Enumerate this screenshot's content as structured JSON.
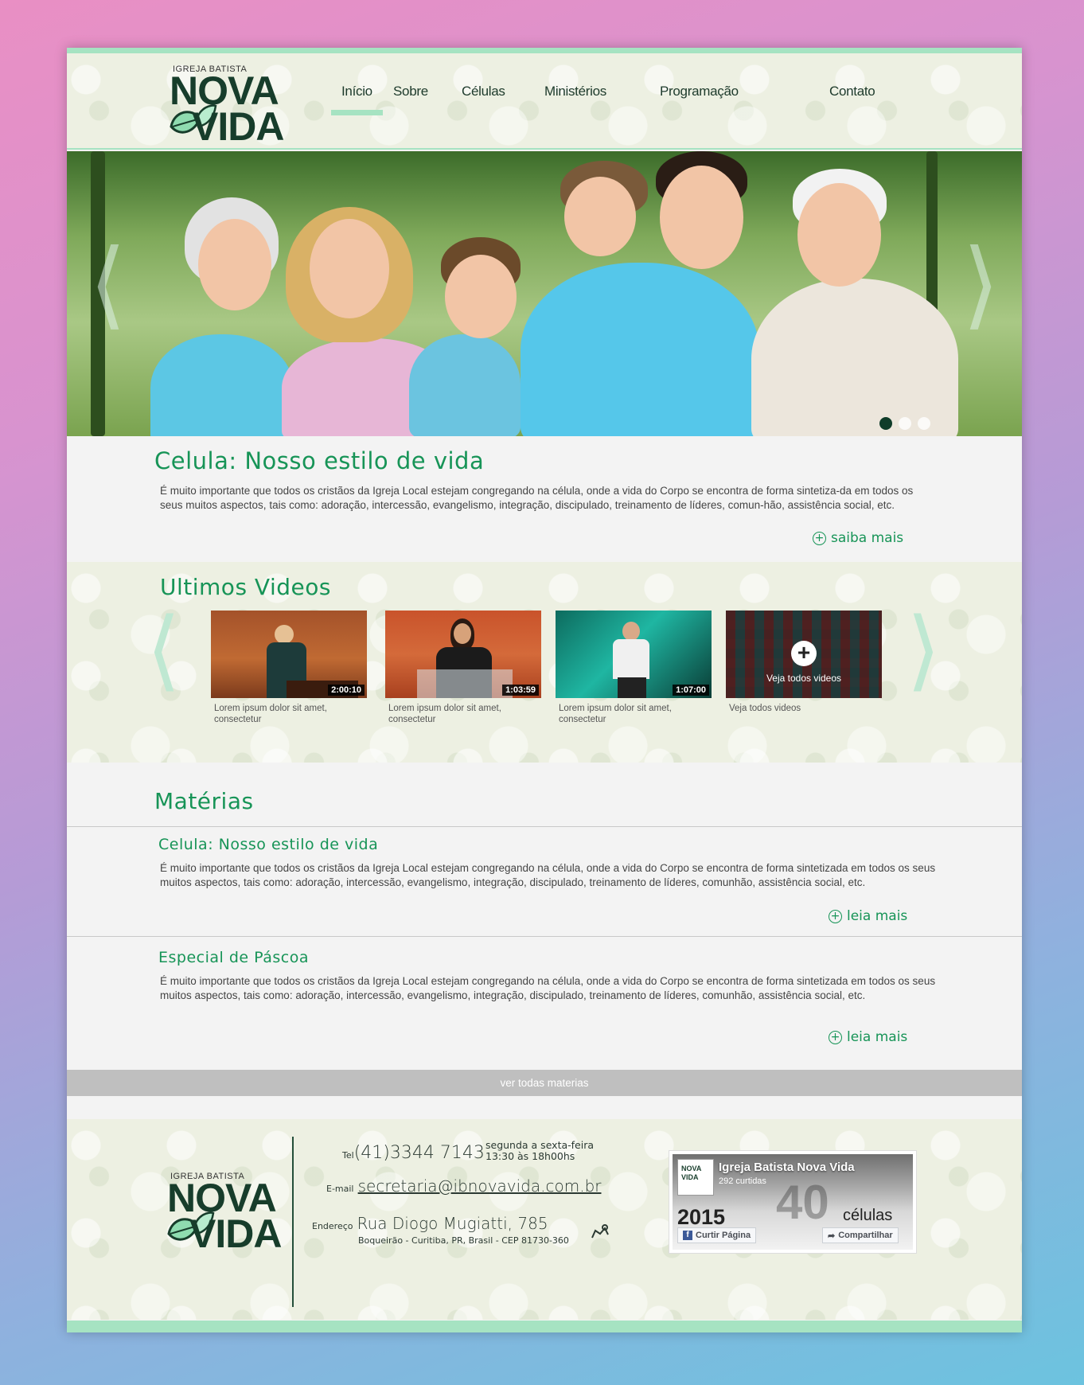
{
  "logo": {
    "pre": "IGREJA BATISTA",
    "line1": "NOVA",
    "line2": "VIDA"
  },
  "nav": [
    {
      "label": "Início"
    },
    {
      "label": "Sobre"
    },
    {
      "label": "Células"
    },
    {
      "label": "Ministérios"
    },
    {
      "label": "Programação"
    },
    {
      "label": "Contato"
    }
  ],
  "hero": {
    "prev": "⟨",
    "next": "⟩",
    "slide_count": 3,
    "active_slide": 1
  },
  "intro": {
    "title": "Celula: Nosso estilo de vida",
    "text": "É muito importante que todos os cristãos da Igreja Local estejam congregando na célula, onde a vida do Corpo se encontra de forma sintetiza-da em todos os seus muitos aspectos, tais como: adoração, intercessão, evangelismo, integração, discipulado, treinamento de líderes, comun-hão, assistência social, etc.",
    "link": "saiba mais"
  },
  "videos": {
    "title": "Ultimos Videos",
    "items": [
      {
        "duration": "2:00:10",
        "caption": "Lorem ipsum dolor sit amet, consectetur"
      },
      {
        "duration": "1:03:59",
        "caption": "Lorem ipsum dolor sit amet, consectetur"
      },
      {
        "duration": "1:07:00",
        "caption": "Lorem ipsum dolor sit amet, consectetur"
      }
    ],
    "see_all": {
      "overlay": "Veja todos videos",
      "caption": "Veja todos videos",
      "plus": "+"
    }
  },
  "materias": {
    "title": "Matérias",
    "articles": [
      {
        "title": "Celula: Nosso estilo de vida",
        "text": "É muito importante que todos os cristãos da Igreja Local estejam congregando na célula, onde a vida do Corpo se encontra de forma sintetizada em todos os seus muitos aspectos, tais como: adoração, intercessão, evangelismo, integração, discipulado, treinamento de líderes, comunhão, assistência social, etc.",
        "link": "leia mais"
      },
      {
        "title": "Especial de Páscoa",
        "text": "É muito importante que todos os cristãos da Igreja Local estejam congregando na célula, onde a vida do Corpo se encontra de forma sintetizada em todos os seus muitos aspectos, tais como: adoração, intercessão, evangelismo, integração, discipulado, treinamento de líderes, comunhão, assistência social, etc.",
        "link": "leia mais"
      }
    ],
    "see_all": "ver todas materias"
  },
  "footer": {
    "tel_label": "Tel",
    "tel": "(41)3344 7143",
    "hours_line1": "segunda a sexta-feira",
    "hours_line2": "13:30 às 18h00hs",
    "email_label": "E-mail",
    "email": "secretaria@ibnovavida.com.br",
    "address_label": "Endereço",
    "address": "Rua Diogo Mugiatti, 785",
    "address_detail": "Boqueirão - Curitiba, PR, Brasil - CEP 81730-360",
    "map_icon": "map-icon"
  },
  "facebook": {
    "page_name": "Igreja Batista Nova Vida",
    "likes": "292 curtidas",
    "year": "2015",
    "big_number": "40",
    "cells": "células",
    "like_button": "Curtir Página",
    "share_button": "Compartilhar",
    "avatar_line1": "NOVA",
    "avatar_line2": "VIDA"
  },
  "colors": {
    "accent": "#179457",
    "mint": "#a6e3c2",
    "dark_green": "#173d2b"
  }
}
